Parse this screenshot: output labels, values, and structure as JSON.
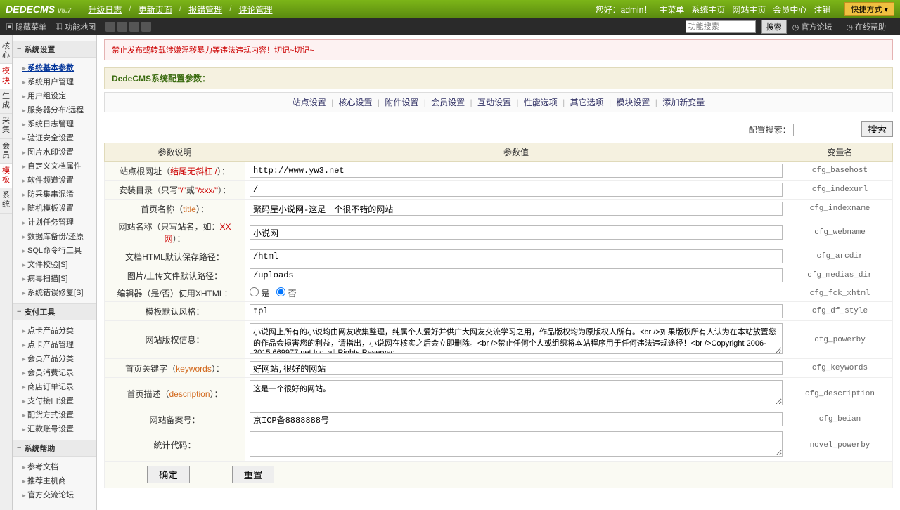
{
  "topbar": {
    "logo": "DEDECMS",
    "version": "v5.7",
    "nav": [
      "升级日志",
      "更新页面",
      "报错管理",
      "评论管理"
    ],
    "welcome": "您好：admin！",
    "links": [
      "主菜单",
      "系统主页",
      "网站主页",
      "会员中心",
      "注销"
    ],
    "quick": "快捷方式 ▾"
  },
  "darkbar": {
    "hide_menu": "隐藏菜单",
    "sitemap": "功能地图",
    "search_ph": "功能搜索",
    "search_btn": "搜索",
    "bbs": "官方论坛",
    "help": "在线帮助"
  },
  "vtabs": [
    "核心",
    "模块",
    "生成",
    "采集",
    "会员",
    "模板",
    "系统"
  ],
  "sidebar": [
    {
      "title": "系统设置",
      "items": [
        "系统基本参数",
        "系统用户管理",
        "用户组设定",
        "服务器分布/远程",
        "系统日志管理",
        "验证安全设置",
        "图片水印设置",
        "自定义文档属性",
        "软件频道设置",
        "防采集串混淆",
        "随机模板设置",
        "计划任务管理",
        "数据库备份/还原",
        "SQL命令行工具",
        "文件校验[S]",
        "病毒扫描[S]",
        "系统错误修复[S]"
      ],
      "active": 0
    },
    {
      "title": "支付工具",
      "items": [
        "点卡产品分类",
        "点卡产品管理",
        "会员产品分类",
        "会员消费记录",
        "商店订单记录",
        "支付接口设置",
        "配货方式设置",
        "汇款账号设置"
      ]
    },
    {
      "title": "系统帮助",
      "items": [
        "参考文档",
        "推荐主机商",
        "官方交流论坛"
      ]
    }
  ],
  "warn": "禁止发布或转载涉嫌淫秽暴力等违法违规内容！切记~切记~",
  "section_title": "DedeCMS系统配置参数：",
  "tabs": [
    "站点设置",
    "核心设置",
    "附件设置",
    "会员设置",
    "互动设置",
    "性能选项",
    "其它选项",
    "模块设置",
    "添加新变量"
  ],
  "searchline": {
    "label": "配置搜索：",
    "btn": "搜索"
  },
  "table": {
    "headers": [
      "参数说明",
      "参数值",
      "变量名"
    ],
    "rows": [
      {
        "label_pre": "站点根网址（",
        "label_red": "结尾无斜杠 /",
        "label_post": "）：",
        "value": "http://www.yw3.net",
        "var": "cfg_basehost",
        "type": "text"
      },
      {
        "label_pre": "安装目录（只写",
        "label_red": "\"/\"",
        "label_mid": "或",
        "label_red2": "\"/xxx/\"",
        "label_post": "）：",
        "value": "/",
        "var": "cfg_indexurl",
        "type": "text"
      },
      {
        "label_pre": "首页名称（",
        "label_orange": "title",
        "label_post": "）：",
        "value": "聚码屋小说网-这是一个很不错的网站",
        "var": "cfg_indexname",
        "type": "text"
      },
      {
        "label_pre": "网站名称（只写站名，如：",
        "label_red": "XX网",
        "label_post": "）：",
        "value": "小说网",
        "var": "cfg_webname",
        "type": "text"
      },
      {
        "label": "文档HTML默认保存路径：",
        "value": "/html",
        "var": "cfg_arcdir",
        "type": "text"
      },
      {
        "label": "图片/上传文件默认路径：",
        "value": "/uploads",
        "var": "cfg_medias_dir",
        "type": "text"
      },
      {
        "label": "编辑器（是/否）使用XHTML：",
        "value_radio": {
          "yes": "是",
          "no": "否",
          "checked": "no"
        },
        "var": "cfg_fck_xhtml",
        "type": "radio"
      },
      {
        "label": "模板默认风格：",
        "value": "tpl",
        "var": "cfg_df_style",
        "type": "text"
      },
      {
        "label": "网站版权信息：",
        "value": "小说网上所有的小说均由网友收集整理，纯属个人爱好并供广大网友交流学习之用，作品版权均为原版权人所有。<br />如果版权所有人认为在本站放置您的作品会损害您的利益，请指出，小说网在核实之后会立即删除。<br />禁止任何个人或组织将本站程序用于任何违法违规途径！<br />Copyright 2006-2015 669977.net Inc. all Rights Reserved",
        "var": "cfg_powerby",
        "type": "textarea"
      },
      {
        "label_pre": "首页关键字（",
        "label_orange": "keywords",
        "label_post": "）：",
        "value": "好网站,很好的网站",
        "var": "cfg_keywords",
        "type": "text"
      },
      {
        "label_pre": "首页描述（",
        "label_orange": "description",
        "label_post": "）：",
        "value": "这是一个很好的网站。",
        "var": "cfg_description",
        "type": "textarea_short"
      },
      {
        "label": "网站备案号：",
        "value": "京ICP备8888888号",
        "var": "cfg_beian",
        "type": "text"
      },
      {
        "label": "统计代码：",
        "value": "",
        "var": "novel_powerby",
        "type": "textarea_short"
      }
    ],
    "btn_ok": "确定",
    "btn_reset": "重置"
  }
}
